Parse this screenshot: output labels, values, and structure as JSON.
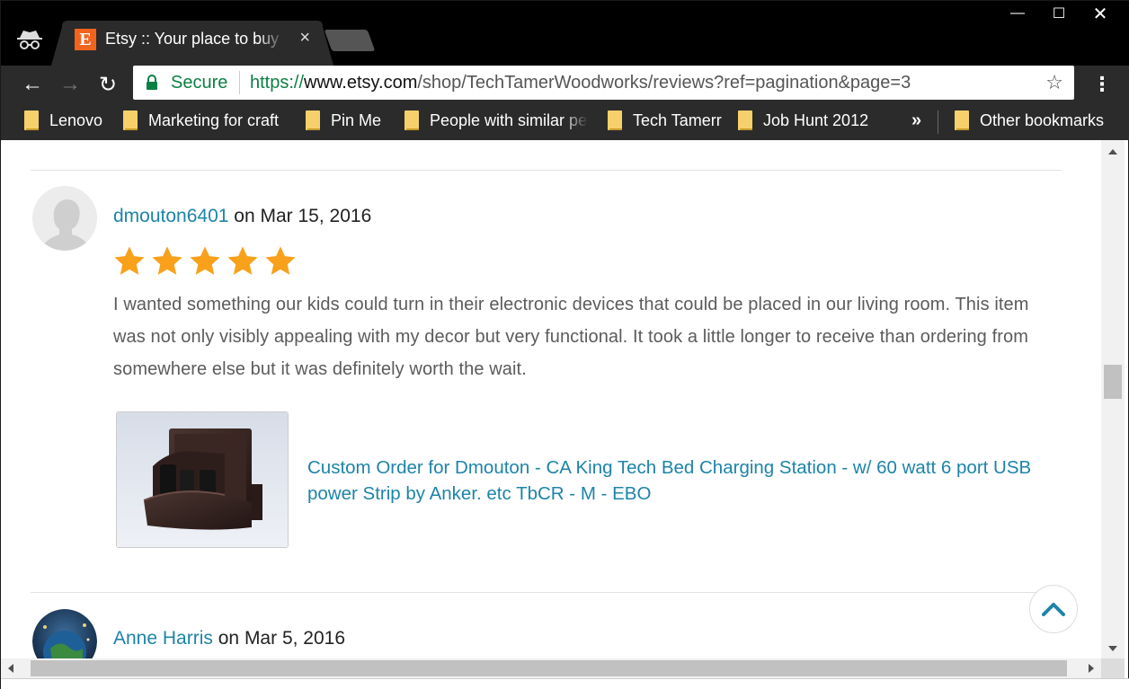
{
  "window": {
    "minimize_glyph": "—",
    "maximize_glyph": "☐",
    "close_glyph": "✕"
  },
  "tab": {
    "favicon_letter": "E",
    "title": "Etsy :: Your place to buy and sell",
    "close_glyph": "×"
  },
  "toolbar": {
    "back_glyph": "←",
    "forward_glyph": "→",
    "reload_glyph": "↻",
    "secure_label": "Secure",
    "url_scheme": "https://",
    "url_host": "www.etsy.com",
    "url_path": "/shop/TechTamerWoodworks/reviews?ref=pagination&page=3",
    "bookmark_star_glyph": "☆",
    "menu_glyph": "⋮"
  },
  "bookmarks": {
    "items": [
      {
        "label": "Lenovo"
      },
      {
        "label": "Marketing for craft"
      },
      {
        "label": "Pin Me"
      },
      {
        "label": "People with similar pe"
      },
      {
        "label": "Tech Tamerr"
      },
      {
        "label": "Job Hunt 2012"
      }
    ],
    "overflow_glyph": "»",
    "other_label": "Other bookmarks"
  },
  "reviews": [
    {
      "reviewer": "dmouton6401",
      "on_word": "on",
      "date": "Mar 15, 2016",
      "rating": 5,
      "text": "I wanted something our kids could turn in their electronic devices that could be placed in our living room. This item was not only visibly appealing with my decor but very functional. It took a little longer to receive than ordering from somewhere else but it was definitely worth the wait.",
      "listing_title": "Custom Order for Dmouton - CA King Tech Bed Charging Station - w/ 60 watt 6 port USB power Strip by Anker. etc TbCR - M - EBO"
    },
    {
      "reviewer": "Anne Harris",
      "on_word": "on",
      "date": "Mar 5, 2016"
    }
  ],
  "colors": {
    "link": "#1d84a8",
    "star": "#f9a11b",
    "secure_green": "#0b8043",
    "etsy_orange": "#f1641e"
  }
}
